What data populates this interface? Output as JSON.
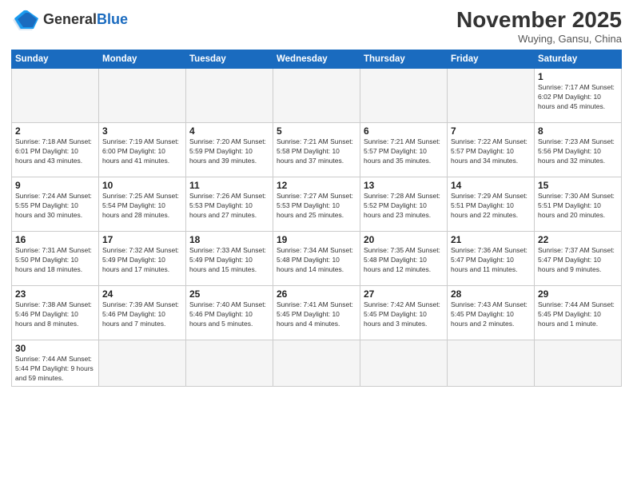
{
  "header": {
    "logo_general": "General",
    "logo_blue": "Blue",
    "month_title": "November 2025",
    "location": "Wuying, Gansu, China"
  },
  "days_of_week": [
    "Sunday",
    "Monday",
    "Tuesday",
    "Wednesday",
    "Thursday",
    "Friday",
    "Saturday"
  ],
  "weeks": [
    [
      {
        "day": "",
        "info": ""
      },
      {
        "day": "",
        "info": ""
      },
      {
        "day": "",
        "info": ""
      },
      {
        "day": "",
        "info": ""
      },
      {
        "day": "",
        "info": ""
      },
      {
        "day": "",
        "info": ""
      },
      {
        "day": "1",
        "info": "Sunrise: 7:17 AM\nSunset: 6:02 PM\nDaylight: 10 hours and 45 minutes."
      }
    ],
    [
      {
        "day": "2",
        "info": "Sunrise: 7:18 AM\nSunset: 6:01 PM\nDaylight: 10 hours and 43 minutes."
      },
      {
        "day": "3",
        "info": "Sunrise: 7:19 AM\nSunset: 6:00 PM\nDaylight: 10 hours and 41 minutes."
      },
      {
        "day": "4",
        "info": "Sunrise: 7:20 AM\nSunset: 5:59 PM\nDaylight: 10 hours and 39 minutes."
      },
      {
        "day": "5",
        "info": "Sunrise: 7:21 AM\nSunset: 5:58 PM\nDaylight: 10 hours and 37 minutes."
      },
      {
        "day": "6",
        "info": "Sunrise: 7:21 AM\nSunset: 5:57 PM\nDaylight: 10 hours and 35 minutes."
      },
      {
        "day": "7",
        "info": "Sunrise: 7:22 AM\nSunset: 5:57 PM\nDaylight: 10 hours and 34 minutes."
      },
      {
        "day": "8",
        "info": "Sunrise: 7:23 AM\nSunset: 5:56 PM\nDaylight: 10 hours and 32 minutes."
      }
    ],
    [
      {
        "day": "9",
        "info": "Sunrise: 7:24 AM\nSunset: 5:55 PM\nDaylight: 10 hours and 30 minutes."
      },
      {
        "day": "10",
        "info": "Sunrise: 7:25 AM\nSunset: 5:54 PM\nDaylight: 10 hours and 28 minutes."
      },
      {
        "day": "11",
        "info": "Sunrise: 7:26 AM\nSunset: 5:53 PM\nDaylight: 10 hours and 27 minutes."
      },
      {
        "day": "12",
        "info": "Sunrise: 7:27 AM\nSunset: 5:53 PM\nDaylight: 10 hours and 25 minutes."
      },
      {
        "day": "13",
        "info": "Sunrise: 7:28 AM\nSunset: 5:52 PM\nDaylight: 10 hours and 23 minutes."
      },
      {
        "day": "14",
        "info": "Sunrise: 7:29 AM\nSunset: 5:51 PM\nDaylight: 10 hours and 22 minutes."
      },
      {
        "day": "15",
        "info": "Sunrise: 7:30 AM\nSunset: 5:51 PM\nDaylight: 10 hours and 20 minutes."
      }
    ],
    [
      {
        "day": "16",
        "info": "Sunrise: 7:31 AM\nSunset: 5:50 PM\nDaylight: 10 hours and 18 minutes."
      },
      {
        "day": "17",
        "info": "Sunrise: 7:32 AM\nSunset: 5:49 PM\nDaylight: 10 hours and 17 minutes."
      },
      {
        "day": "18",
        "info": "Sunrise: 7:33 AM\nSunset: 5:49 PM\nDaylight: 10 hours and 15 minutes."
      },
      {
        "day": "19",
        "info": "Sunrise: 7:34 AM\nSunset: 5:48 PM\nDaylight: 10 hours and 14 minutes."
      },
      {
        "day": "20",
        "info": "Sunrise: 7:35 AM\nSunset: 5:48 PM\nDaylight: 10 hours and 12 minutes."
      },
      {
        "day": "21",
        "info": "Sunrise: 7:36 AM\nSunset: 5:47 PM\nDaylight: 10 hours and 11 minutes."
      },
      {
        "day": "22",
        "info": "Sunrise: 7:37 AM\nSunset: 5:47 PM\nDaylight: 10 hours and 9 minutes."
      }
    ],
    [
      {
        "day": "23",
        "info": "Sunrise: 7:38 AM\nSunset: 5:46 PM\nDaylight: 10 hours and 8 minutes."
      },
      {
        "day": "24",
        "info": "Sunrise: 7:39 AM\nSunset: 5:46 PM\nDaylight: 10 hours and 7 minutes."
      },
      {
        "day": "25",
        "info": "Sunrise: 7:40 AM\nSunset: 5:46 PM\nDaylight: 10 hours and 5 minutes."
      },
      {
        "day": "26",
        "info": "Sunrise: 7:41 AM\nSunset: 5:45 PM\nDaylight: 10 hours and 4 minutes."
      },
      {
        "day": "27",
        "info": "Sunrise: 7:42 AM\nSunset: 5:45 PM\nDaylight: 10 hours and 3 minutes."
      },
      {
        "day": "28",
        "info": "Sunrise: 7:43 AM\nSunset: 5:45 PM\nDaylight: 10 hours and 2 minutes."
      },
      {
        "day": "29",
        "info": "Sunrise: 7:44 AM\nSunset: 5:45 PM\nDaylight: 10 hours and 1 minute."
      }
    ],
    [
      {
        "day": "30",
        "info": "Sunrise: 7:44 AM\nSunset: 5:44 PM\nDaylight: 9 hours and 59 minutes."
      },
      {
        "day": "",
        "info": ""
      },
      {
        "day": "",
        "info": ""
      },
      {
        "day": "",
        "info": ""
      },
      {
        "day": "",
        "info": ""
      },
      {
        "day": "",
        "info": ""
      },
      {
        "day": "",
        "info": ""
      }
    ]
  ]
}
